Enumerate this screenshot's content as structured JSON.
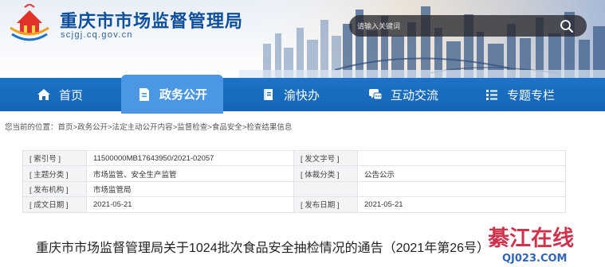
{
  "header": {
    "site_title": "重庆市市场监督管理局",
    "site_domain": "scjgj.cq.gov.cn",
    "search_placeholder": "请输入关键词"
  },
  "nav": {
    "items": [
      {
        "label": "首页",
        "icon": "home-icon"
      },
      {
        "label": "政务公开",
        "icon": "document-icon",
        "active": true
      },
      {
        "label": "渝快办",
        "icon": "book-icon"
      },
      {
        "label": "互动交流",
        "icon": "chat-icon"
      },
      {
        "label": "专题专栏",
        "icon": "list-icon"
      }
    ]
  },
  "breadcrumb": {
    "prefix": "您当前的位置：",
    "items": [
      "首页",
      "政务公开",
      "法定主动公开内容",
      "监督检查",
      "食品安全",
      "检查结果信息"
    ],
    "separator": ">"
  },
  "meta": {
    "index_label": "[ 索引号 ]",
    "index_value": "11500000MB17643950/2021-02057",
    "doc_no_label": "[ 发文字号 ]",
    "doc_no_value": "",
    "topic_label": "[ 主题分类 ]",
    "topic_value": "市场监管、安全生产监管",
    "genre_label": "[ 体裁分类 ]",
    "genre_value": "公告公示",
    "issuer_label": "[ 发布机构 ]",
    "issuer_value": "市场监管局",
    "created_label": "[ 成文日期 ]",
    "created_value": "2021-05-21",
    "published_label": "[ 发布日期 ]",
    "published_value": "2021-05-21"
  },
  "article": {
    "title": "重庆市市场监督管理局关于1024批次食品安全抽检情况的通告（2021年第26号）"
  },
  "watermark": {
    "text": "綦江在线",
    "domain": "QJ023.COM"
  },
  "colors": {
    "nav_bg": "#1668ba",
    "nav_active": "#4b97e4",
    "title_blue": "#0d4f9c",
    "watermark_red": "#c8102e",
    "watermark_blue": "#1a55b0"
  }
}
